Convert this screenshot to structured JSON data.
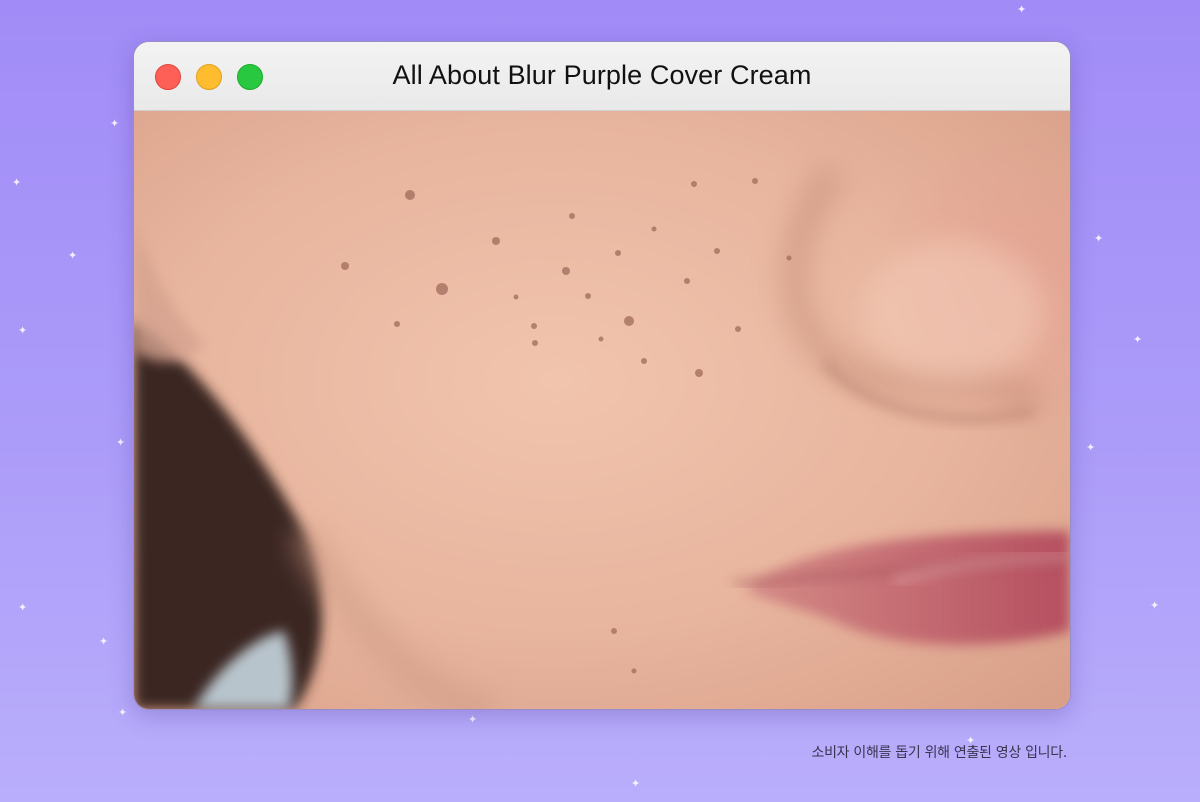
{
  "window": {
    "title": "All About Blur Purple Cover Cream",
    "controls": [
      "close",
      "minimize",
      "maximize"
    ]
  },
  "video": {
    "content": "close-up-skin-video-frame"
  },
  "disclaimer": "소비자 이해를 돕기 위해 연출된 영상 입니다.",
  "colors": {
    "background_top": "#a18cf7",
    "background_bottom": "#b9aefb",
    "close": "#fe5f57",
    "minimize": "#febc2e",
    "maximize": "#28c840",
    "titlebar": "#ececec"
  }
}
